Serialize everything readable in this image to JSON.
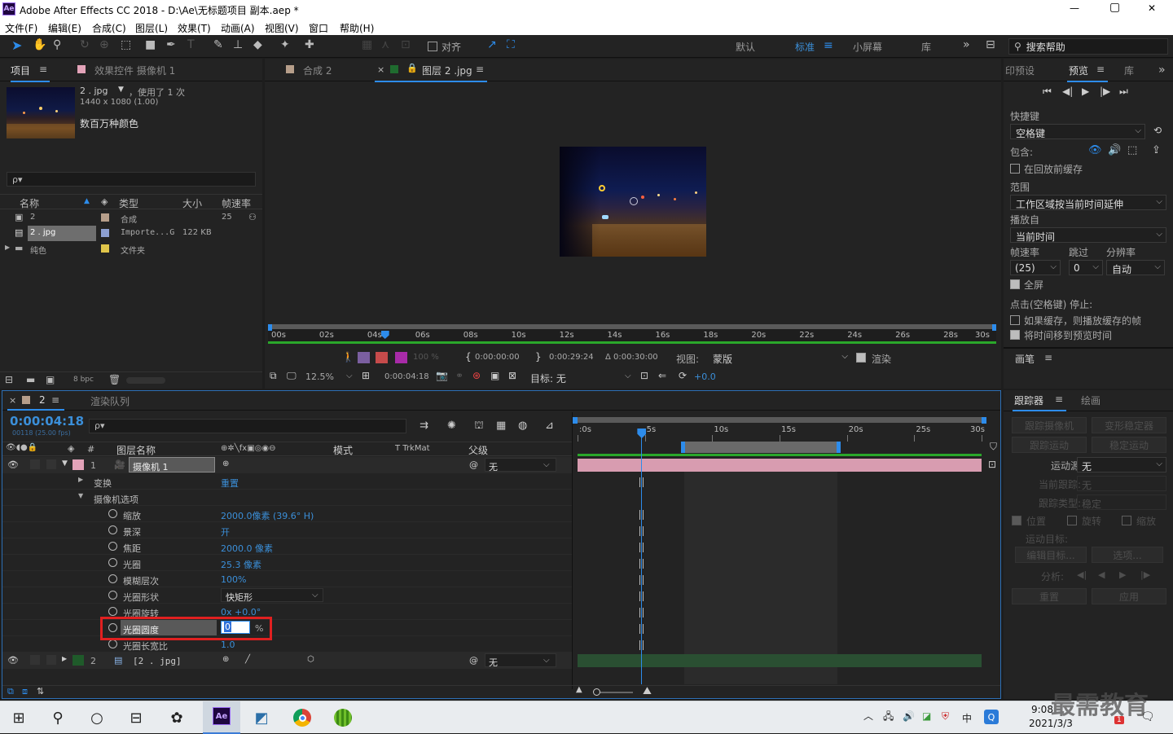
{
  "window": {
    "title": "Adobe After Effects CC 2018 - D:\\Ae\\无标题项目 副本.aep *",
    "logo": "Ae",
    "min": "—",
    "max": "▢",
    "close": "✕"
  },
  "menu": [
    "文件(F)",
    "编辑(E)",
    "合成(C)",
    "图层(L)",
    "效果(T)",
    "动画(A)",
    "视图(V)",
    "窗口",
    "帮助(H)"
  ],
  "toolbar": {
    "snap": "对齐",
    "workspaces": [
      "默认",
      "标准",
      "小屏幕",
      "库"
    ],
    "active_workspace": "标准",
    "search_placeholder": "搜索帮助"
  },
  "project": {
    "tab_project": "项目",
    "tab_effects": "效果控件 摄像机 1",
    "item_name": "2 . jpg",
    "item_used": "，使用了 1 次",
    "item_dims": "1440 x 1080 (1.00)",
    "item_colors": "数百万种颜色",
    "search_placeholder": "ρ▾",
    "cols": [
      "名称",
      "类型",
      "大小",
      "帧速率"
    ],
    "items": [
      {
        "name": "2",
        "type": "合成",
        "size": "",
        "fps": "25",
        "color": "#b69e8a"
      },
      {
        "name": "2 . jpg",
        "type": "Importe...G",
        "size": "122 KB",
        "fps": "",
        "color": "#8c9fd1"
      },
      {
        "name": "纯色",
        "type": "文件夹",
        "size": "",
        "fps": "",
        "color": "#e0c54a"
      }
    ],
    "bpc": "8 bpc"
  },
  "viewer": {
    "tab_comp": "合成 2",
    "tab_layer": "图层 2 .jpg",
    "ruler": [
      "00s",
      "02s",
      "04s",
      "06s",
      "08s",
      "10s",
      "12s",
      "14s",
      "16s",
      "18s",
      "20s",
      "22s",
      "24s",
      "26s",
      "28s",
      "30s"
    ],
    "playhead_fraction": 0.158,
    "ctrl1": {
      "opacity": "100 %",
      "in": "0:00:00:00",
      "out": "0:00:29:24",
      "dur": "Δ 0:00:30:00",
      "view_label": "视图:",
      "view_val": "蒙版",
      "render": "渲染"
    },
    "ctrl2": {
      "zoom": "12.5%",
      "time": "0:00:04:18",
      "target": "目标: 无",
      "exposure": "+0.0"
    }
  },
  "preview": {
    "tab_presets": "印预设",
    "tab_preview": "预览",
    "tab_lib": "库",
    "shortcut_label": "快捷键",
    "shortcut": "空格键",
    "include": "包含:",
    "cache": "在回放前缓存",
    "range_label": "范围",
    "range": "工作区域按当前时间延伸",
    "play_from_label": "播放自",
    "play_from": "当前时间",
    "fps_label": "帧速率",
    "skip_label": "跳过",
    "res_label": "分辨率",
    "fps": "(25)",
    "skip": "0",
    "res": "自动",
    "fullscreen": "全屏",
    "stop_label": "点击(空格键) 停止:",
    "opt1": "如果缓存，则播放缓存的帧",
    "opt2": "将时间移到预览时间",
    "brush": "画笔"
  },
  "timeline": {
    "tab_comp": "2",
    "tab_render": "渲染队列",
    "timecode": "0:00:04:18",
    "frames": "00118 (25.00 fps)",
    "cols": {
      "name": "图层名称",
      "mode": "模式",
      "trk": "T  TrkMat",
      "parent": "父级"
    },
    "ruler": [
      "0s",
      "5s",
      "10s",
      "15s",
      "20s",
      "25s",
      "30s"
    ],
    "layers": [
      {
        "num": "1",
        "name": "摄像机 1",
        "parent": "无"
      },
      {
        "num": "2",
        "name": "[2 . jpg]",
        "parent": "无"
      }
    ],
    "props": [
      {
        "name": "变换",
        "value": "重置"
      },
      {
        "name": "摄像机选项",
        "value": ""
      },
      {
        "name": "缩放",
        "value": "2000.0像素 (39.6° H)"
      },
      {
        "name": "景深",
        "value": "开"
      },
      {
        "name": "焦距",
        "value": "2000.0 像素"
      },
      {
        "name": "光圈",
        "value": "25.3 像素"
      },
      {
        "name": "模糊层次",
        "value": "100%"
      },
      {
        "name": "光圈形状",
        "value": "快矩形"
      },
      {
        "name": "光圈旋转",
        "value": "0x +0.0°"
      },
      {
        "name": "光圈圆度",
        "value": "0",
        "unit": "%"
      },
      {
        "name": "光圈长宽比",
        "value": "1.0"
      }
    ]
  },
  "tracker": {
    "tab_tracker": "跟踪器",
    "tab_paint": "绘画",
    "btn_cam": "跟踪摄像机",
    "btn_warp": "变形稳定器",
    "btn_motion": "跟踪运动",
    "btn_stab": "稳定运动",
    "source_label": "运动源:",
    "source": "无",
    "current_label": "当前跟踪:",
    "current": "无",
    "type_label": "跟踪类型:",
    "type": "稳定",
    "pos": "位置",
    "rot": "旋转",
    "scale": "缩放",
    "target_label": "运动目标:",
    "edit_target": "编辑目标...",
    "options": "选项...",
    "analyze": "分析:",
    "reset": "重置",
    "apply": "应用"
  },
  "taskbar": {
    "time": "9:08",
    "date": "2021/3/3",
    "ime": "中",
    "badge": "1",
    "watermark": "最需教育"
  }
}
